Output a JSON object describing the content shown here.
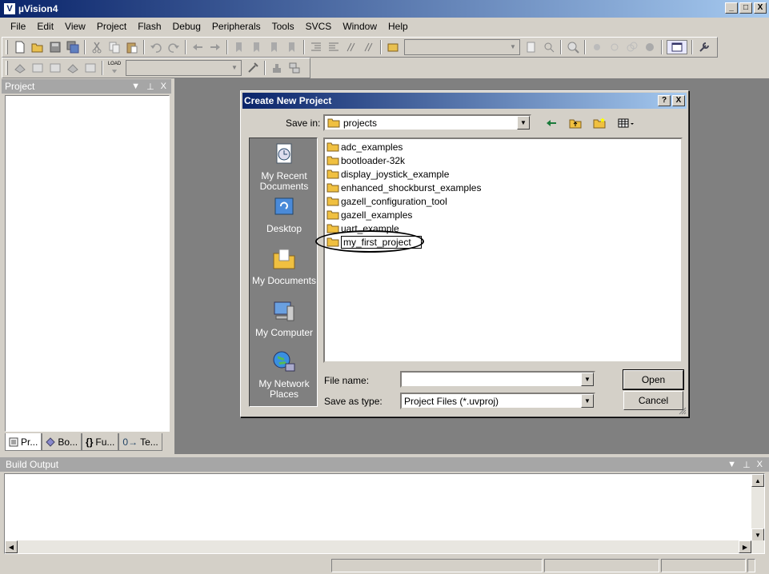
{
  "window": {
    "title": "µVision4",
    "app_icon": "V",
    "controls": [
      "_",
      "□",
      "X"
    ]
  },
  "menu": [
    "File",
    "Edit",
    "View",
    "Project",
    "Flash",
    "Debug",
    "Peripherals",
    "Tools",
    "SVCS",
    "Window",
    "Help"
  ],
  "toolbar2": {
    "load_label": "LOAD"
  },
  "project_panel": {
    "title": "Project",
    "controls": [
      "▼",
      "⊥",
      "X"
    ],
    "tabs": [
      "Pr...",
      "Bo...",
      "Fu...",
      "Te..."
    ]
  },
  "dialog": {
    "title": "Create New Project",
    "controls": [
      "?",
      "X"
    ],
    "save_in_label": "Save in:",
    "save_in_value": "projects",
    "places": [
      "My Recent Documents",
      "Desktop",
      "My Documents",
      "My Computer",
      "My Network Places"
    ],
    "files": [
      "adc_examples",
      "bootloader-32k",
      "display_joystick_example",
      "enhanced_shockburst_examples",
      "gazell_configuration_tool",
      "gazell_examples",
      "uart_example",
      "my_first_project"
    ],
    "file_name_label": "File name:",
    "file_name_value": "",
    "save_as_type_label": "Save as type:",
    "save_as_type_value": "Project Files (*.uvproj)",
    "open_label": "Open",
    "cancel_label": "Cancel"
  },
  "build_output": {
    "title": "Build Output",
    "controls": [
      "▼",
      "⊥",
      "X"
    ]
  },
  "colors": {
    "title_start": "#0a246a",
    "title_end": "#a6caf0",
    "face": "#d4d0c8",
    "mdi": "#808080",
    "folder": "#f0c040"
  }
}
